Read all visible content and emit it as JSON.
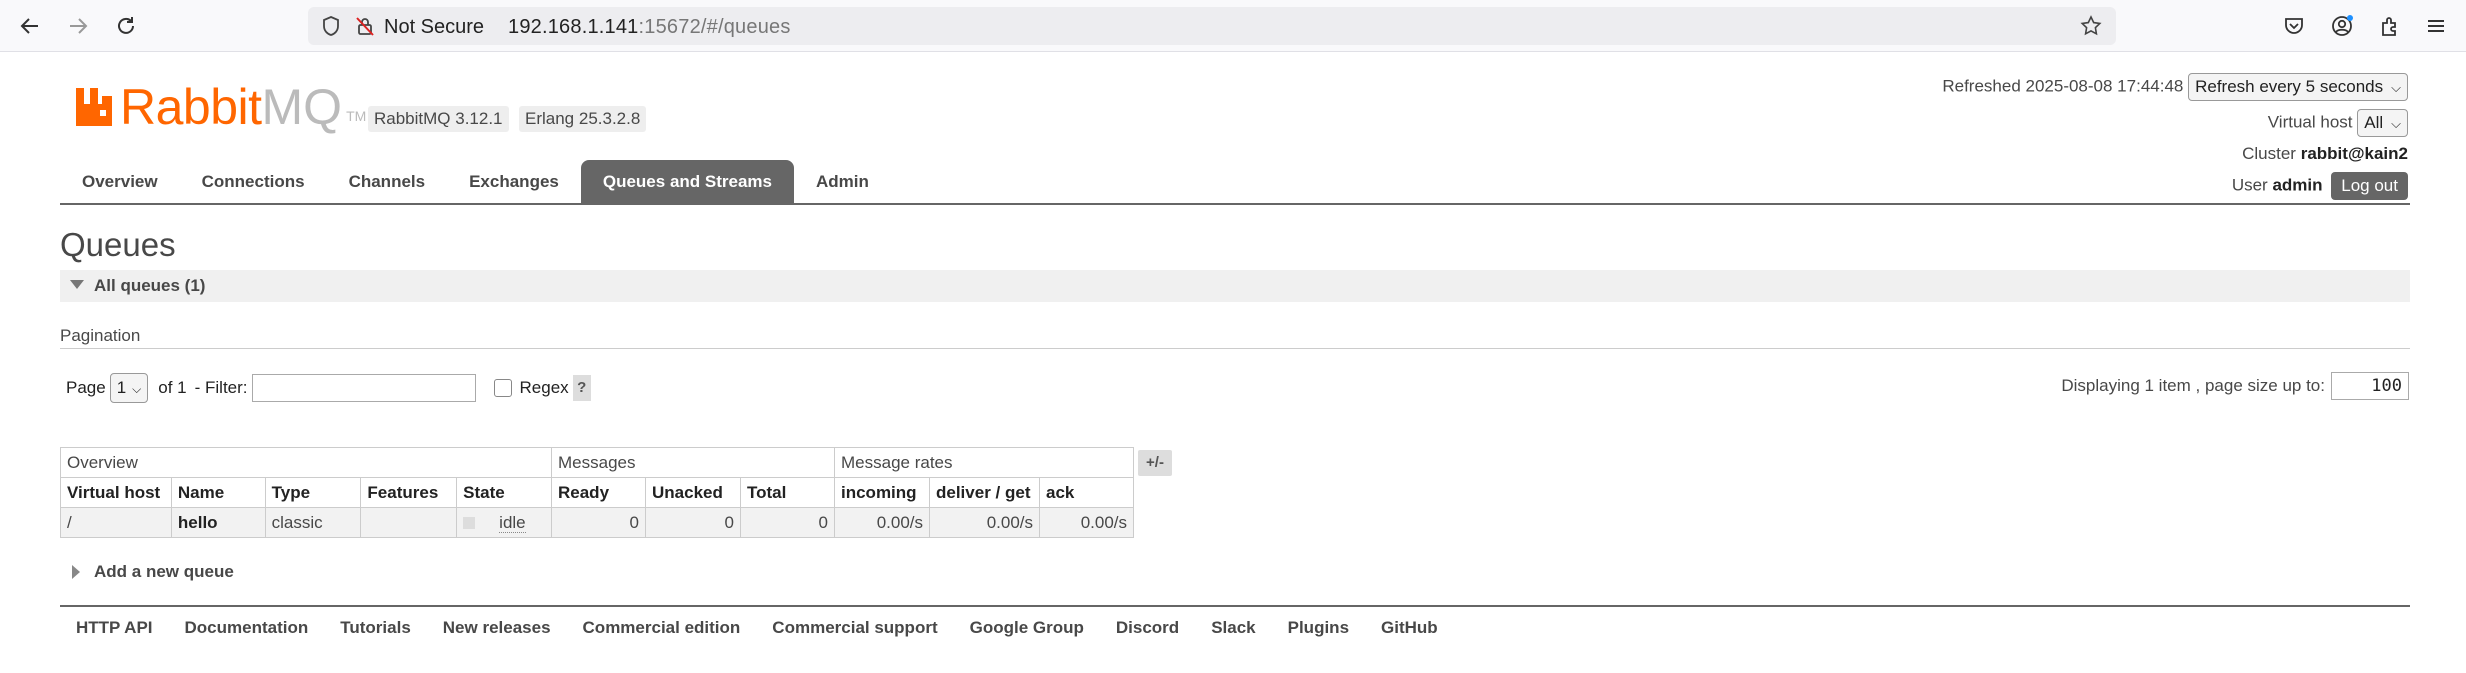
{
  "browser": {
    "not_secure": "Not Secure",
    "url_host": "192.168.1.141",
    "url_rest": ":15672/#/queues"
  },
  "header": {
    "logo_rabbit": "Rabbit",
    "logo_mq": "MQ",
    "logo_tm": "TM",
    "version_badge": "RabbitMQ 3.12.1",
    "erlang_badge": "Erlang 25.3.2.8",
    "refreshed_label": "Refreshed 2025-08-08 17:44:48",
    "refresh_select": "Refresh every 5 seconds",
    "vhost_label": "Virtual host",
    "vhost_select": "All",
    "cluster_label": "Cluster",
    "cluster_value": "rabbit@kain2",
    "user_label": "User",
    "user_value": "admin",
    "logout_label": "Log out"
  },
  "tabs": [
    {
      "label": "Overview"
    },
    {
      "label": "Connections"
    },
    {
      "label": "Channels"
    },
    {
      "label": "Exchanges"
    },
    {
      "label": "Queues and Streams",
      "active": true
    },
    {
      "label": "Admin"
    }
  ],
  "main": {
    "title": "Queues",
    "section_label": "All queues (1)",
    "pagination_label": "Pagination",
    "page_label": "Page",
    "page_select": "1",
    "of_label": "of 1",
    "filter_label": "- Filter:",
    "regex_label": "Regex",
    "help_label": "?",
    "displaying_label": "Displaying 1 item , page size up to:",
    "page_size": "100",
    "plusminus": "+/-",
    "add_queue_label": "Add a new queue"
  },
  "table": {
    "groups": [
      "Overview",
      "Messages",
      "Message rates"
    ],
    "columns": [
      "Virtual host",
      "Name",
      "Type",
      "Features",
      "State",
      "Ready",
      "Unacked",
      "Total",
      "incoming",
      "deliver / get",
      "ack"
    ],
    "rows": [
      {
        "vhost": "/",
        "name": "hello",
        "type": "classic",
        "features": "",
        "state": "idle",
        "ready": "0",
        "unacked": "0",
        "total": "0",
        "incoming": "0.00/s",
        "deliver_get": "0.00/s",
        "ack": "0.00/s"
      }
    ]
  },
  "footer": {
    "links": [
      "HTTP API",
      "Documentation",
      "Tutorials",
      "New releases",
      "Commercial edition",
      "Commercial support",
      "Google Group",
      "Discord",
      "Slack",
      "Plugins",
      "GitHub"
    ]
  },
  "colors": {
    "brand": "#ff6600",
    "tab_active": "#666666"
  }
}
